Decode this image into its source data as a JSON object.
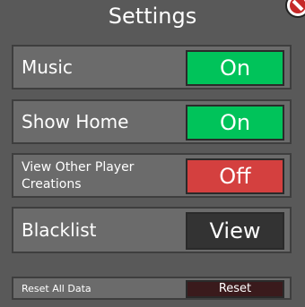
{
  "window": {
    "title": "Settings"
  },
  "settings": {
    "music": {
      "label": "Music",
      "button": "On"
    },
    "show_home": {
      "label": "Show Home",
      "button": "On"
    },
    "view_creations": {
      "label_line1": "View Other Player",
      "label_line2": "Creations",
      "button": "Off"
    },
    "blacklist": {
      "label": "Blacklist",
      "button": "View"
    },
    "reset": {
      "label": "Reset All Data",
      "button": "Reset"
    }
  },
  "colors": {
    "on": "#00c35a",
    "off": "#d4403f",
    "view": "#333333",
    "reset": "#3a1a1c",
    "close": "#c62828"
  },
  "icons": {
    "close": "no-entry-icon"
  }
}
